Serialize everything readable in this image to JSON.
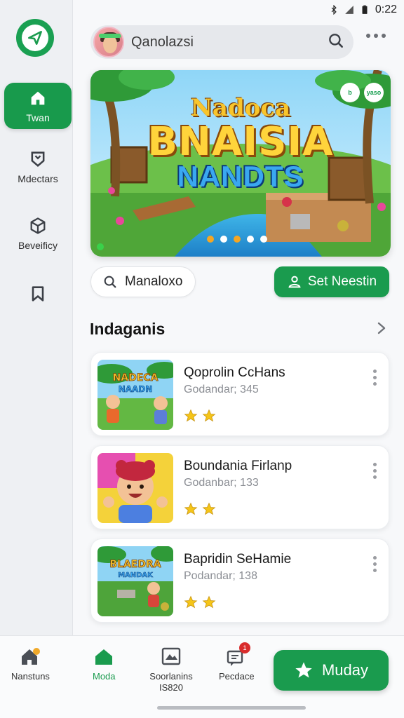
{
  "status": {
    "time": "0:22"
  },
  "sidebar": {
    "items": [
      {
        "label": "Twan",
        "icon": "home-icon",
        "active": true
      },
      {
        "label": "Mdectars",
        "icon": "shield-icon",
        "active": false
      },
      {
        "label": "Beveificy",
        "icon": "cube-icon",
        "active": false
      },
      {
        "label": "",
        "icon": "bookmark-icon",
        "active": false
      }
    ]
  },
  "header": {
    "search_text": "Qanolazsi"
  },
  "banner": {
    "title_line1": "Nadoca",
    "title_line2": "BNAISIA",
    "title_line3": "NANDTS",
    "badge_left": "b",
    "badge_right": "yaso",
    "active_dot": 2,
    "dot_count": 5
  },
  "actions": {
    "search_pill": "Manaloxo",
    "primary_button": "Set Neestin"
  },
  "section": {
    "title": "Indaganis"
  },
  "cards": [
    {
      "title": "Qoprolin CcHans",
      "subtitle": "Godandar; 345",
      "stars": 2
    },
    {
      "title": "Boundania Firlanp",
      "subtitle": "Godanbar; 133",
      "stars": 2
    },
    {
      "title": "Bapridin SeHamie",
      "subtitle": "Podandar; 138",
      "stars": 2
    }
  ],
  "bottom_nav": {
    "items": [
      {
        "label": "Nanstuns",
        "icon": "home-alert-icon"
      },
      {
        "label": "Moda",
        "icon": "home-icon",
        "active": true
      },
      {
        "label": "Soorlanins\nIS820",
        "icon": "gallery-icon"
      },
      {
        "label": "Pecdace",
        "icon": "chat-icon",
        "badge": "1"
      }
    ],
    "fab_label": "Muday"
  },
  "colors": {
    "accent": "#1a9b4e",
    "star": "#f5c518"
  }
}
